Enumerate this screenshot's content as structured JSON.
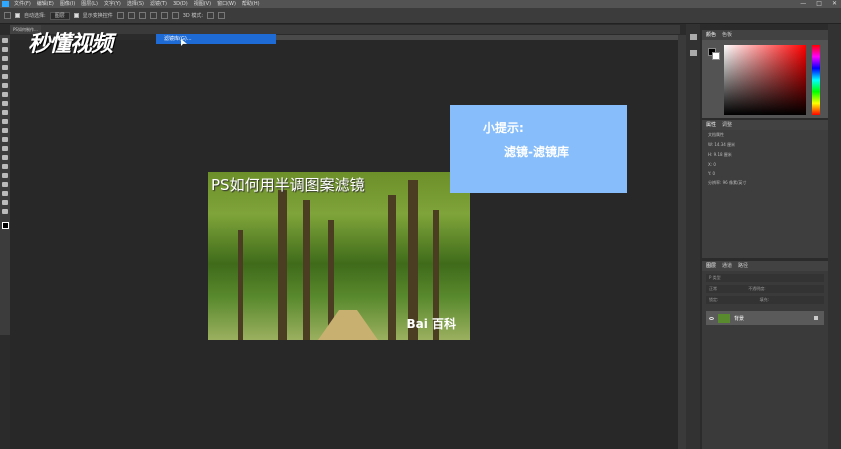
{
  "menubar": {
    "items": [
      "文件(F)",
      "编辑(E)",
      "图像(I)",
      "图层(L)",
      "文字(Y)",
      "选择(S)",
      "滤镜(T)",
      "3D(D)",
      "视图(V)",
      "窗口(W)",
      "帮助(H)"
    ],
    "window_controls": [
      "—",
      "□",
      "✕"
    ]
  },
  "options": {
    "auto_select_label": "自动选择:",
    "auto_select_value": "图层",
    "show_transform_label": "显示变换控件",
    "mode_3d_label": "3D 模式:"
  },
  "document": {
    "tab_label": "PS如何制作...",
    "filter_menu_item": "滤镜库(G)..."
  },
  "watermark": "秒懂视频",
  "canvas": {
    "photo_title": "PS如何用半调图案滤镜",
    "photo_logo": "Bai 百科"
  },
  "hint": {
    "title": "小提示:",
    "body": "滤镜-滤镜库"
  },
  "panels": {
    "color_tabs": [
      "颜色",
      "色板"
    ],
    "props_tabs": [
      "属性",
      "调整"
    ],
    "props_title": "文档属性",
    "props_w": "W: 14.34 厘米",
    "props_h": "H: 9.18 厘米",
    "props_x": "X: 0",
    "props_y": "Y: 0",
    "props_res": "分辨率: 96 像素/英寸",
    "layers_tabs": [
      "图层",
      "通道",
      "路径"
    ],
    "layers_kind": "P 类型",
    "layers_mode": "正常",
    "layers_opacity": "不透明度:",
    "layers_lock": "锁定:",
    "layers_fill": "填充:",
    "layer_name": "背景"
  }
}
